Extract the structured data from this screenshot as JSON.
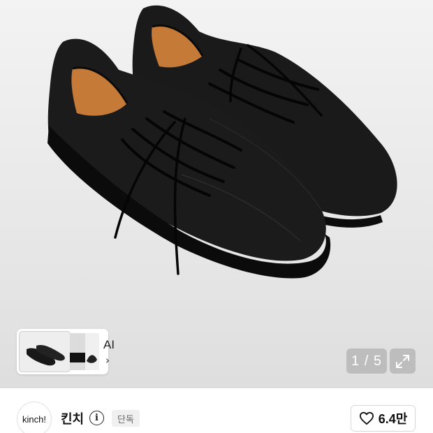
{
  "gallery": {
    "image": "black leather lace-up sneakers, pair",
    "thumbnail_label": "AI",
    "thumbnail_chevron": "›",
    "pager_text": "1 / 5",
    "expand_icon": "expand-arrows-icon"
  },
  "brand": {
    "logo_text": "kinch!",
    "name": "킨치",
    "info_icon": "i",
    "badge": "단독",
    "likes": "6.4만"
  },
  "colors": {
    "overlay": "#bdbdbd",
    "shoe": "#161616",
    "lining": "#c57a38"
  }
}
